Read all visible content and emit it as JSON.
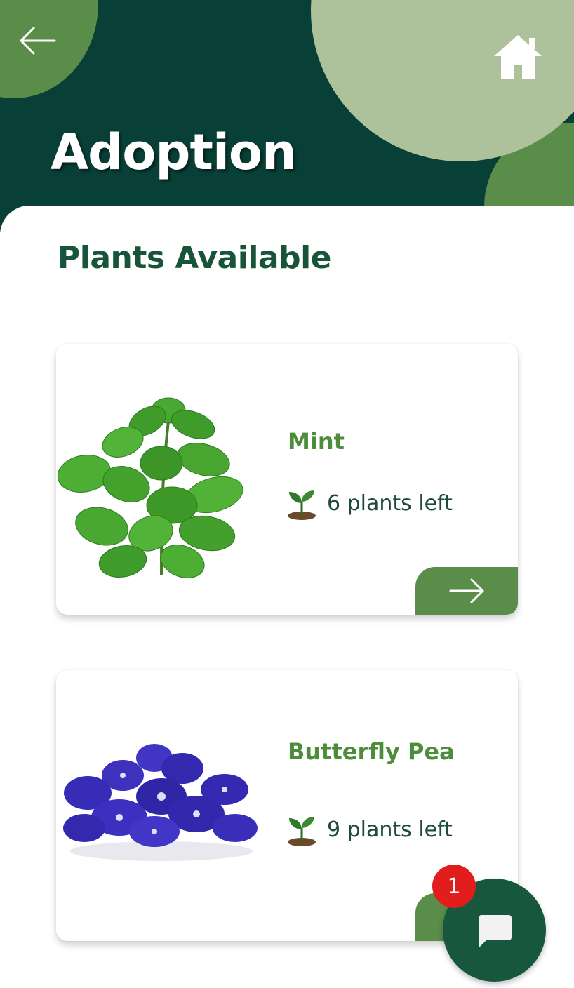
{
  "header": {
    "title": "Adoption",
    "back_icon": "arrow-left-icon",
    "home_icon": "home-icon"
  },
  "section": {
    "title": "Plants Available"
  },
  "plants": [
    {
      "name": "Mint",
      "stock_text": "6 plants left",
      "image": "mint-plant-image",
      "action_icon": "arrow-right-icon"
    },
    {
      "name": "Butterfly Pea",
      "stock_text": "9 plants left",
      "image": "butterfly-pea-image",
      "action_icon": "arrow-right-icon"
    }
  ],
  "chat": {
    "icon": "chat-bubble-icon",
    "badge_count": "1"
  },
  "colors": {
    "header_bg": "#083f36",
    "accent_green": "#5a8c4a",
    "light_green": "#adc29a",
    "title_green": "#17543a",
    "badge_red": "#e11d1d"
  }
}
